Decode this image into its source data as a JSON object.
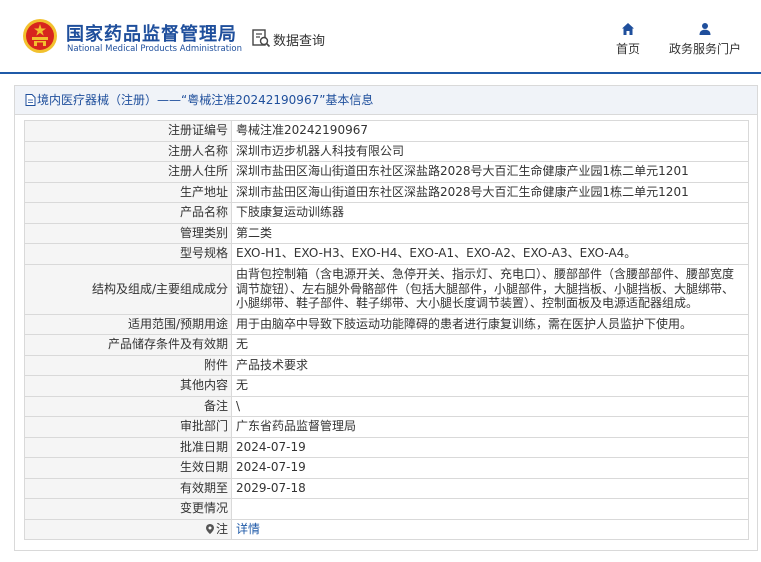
{
  "header": {
    "org_name_cn": "国家药品监督管理局",
    "org_name_en": "National Medical Products Administration",
    "query_label": "数据查询",
    "nav": {
      "home_label": "首页",
      "portal_label": "政务服务门户"
    }
  },
  "panel": {
    "breadcrumb_category": "境内医疗器械（注册）",
    "breadcrumb_sep": "——",
    "breadcrumb_record": "“粤械注准20242190967”基本信息"
  },
  "fields": [
    {
      "label": "注册证编号",
      "value": "粤械注准20242190967"
    },
    {
      "label": "注册人名称",
      "value": "深圳市迈步机器人科技有限公司"
    },
    {
      "label": "注册人住所",
      "value": "深圳市盐田区海山街道田东社区深盐路2028号大百汇生命健康产业园1栋二单元1201"
    },
    {
      "label": "生产地址",
      "value": "深圳市盐田区海山街道田东社区深盐路2028号大百汇生命健康产业园1栋二单元1201"
    },
    {
      "label": "产品名称",
      "value": "下肢康复运动训练器"
    },
    {
      "label": "管理类别",
      "value": "第二类"
    },
    {
      "label": "型号规格",
      "value": "EXO-H1、EXO-H3、EXO-H4、EXO-A1、EXO-A2、EXO-A3、EXO-A4。"
    },
    {
      "label": "结构及组成/主要组成成分",
      "value": "由背包控制箱（含电源开关、急停开关、指示灯、充电口）、腰部部件（含腰部部件、腰部宽度调节旋钮）、左右腿外骨骼部件（包括大腿部件，小腿部件，大腿挡板、小腿挡板、大腿绑带、小腿绑带、鞋子部件、鞋子绑带、大小腿长度调节装置）、控制面板及电源适配器组成。"
    },
    {
      "label": "适用范围/预期用途",
      "value": "用于由脑卒中导致下肢运动功能障碍的患者进行康复训练，需在医护人员监护下使用。"
    },
    {
      "label": "产品储存条件及有效期",
      "value": "无"
    },
    {
      "label": "附件",
      "value": "产品技术要求"
    },
    {
      "label": "其他内容",
      "value": "无"
    },
    {
      "label": "备注",
      "value": "\\"
    },
    {
      "label": "审批部门",
      "value": "广东省药品监督管理局"
    },
    {
      "label": "批准日期",
      "value": "2024-07-19"
    },
    {
      "label": "生效日期",
      "value": "2024-07-19"
    },
    {
      "label": "有效期至",
      "value": "2029-07-18"
    },
    {
      "label": "变更情况",
      "value": ""
    },
    {
      "label": "注",
      "value": "详情"
    }
  ],
  "colors": {
    "brand": "#1f4f9c",
    "link": "#1f5aa8",
    "emblem_red": "#d7261e",
    "emblem_gold": "#f2c12e"
  },
  "icons": [
    "national-emblem-icon",
    "query-icon",
    "home-icon",
    "user-icon",
    "page-icon",
    "location-pin-icon"
  ]
}
